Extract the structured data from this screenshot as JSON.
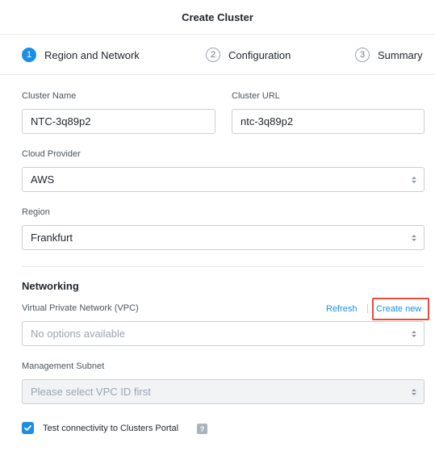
{
  "header": {
    "title": "Create Cluster"
  },
  "steps": [
    {
      "number": "1",
      "label": "Region and Network",
      "active": true
    },
    {
      "number": "2",
      "label": "Configuration",
      "active": false
    },
    {
      "number": "3",
      "label": "Summary",
      "active": false
    }
  ],
  "form": {
    "cluster_name": {
      "label": "Cluster Name",
      "value": "NTC-3q89p2"
    },
    "cluster_url": {
      "label": "Cluster URL",
      "value": "ntc-3q89p2"
    },
    "cloud_provider": {
      "label": "Cloud Provider",
      "value": "AWS"
    },
    "region": {
      "label": "Region",
      "value": "Frankfurt"
    }
  },
  "networking": {
    "title": "Networking",
    "vpc": {
      "label": "Virtual Private Network (VPC)",
      "refresh_label": "Refresh",
      "create_new_label": "Create new",
      "placeholder": "No options available"
    },
    "subnet": {
      "label": "Management Subnet",
      "placeholder": "Please select VPC ID first"
    },
    "test_connectivity": {
      "label": "Test connectivity to Clusters Portal",
      "checked": true,
      "help_icon": "?"
    }
  },
  "colors": {
    "accent": "#1b8fe8",
    "highlight": "#e84a3c"
  }
}
